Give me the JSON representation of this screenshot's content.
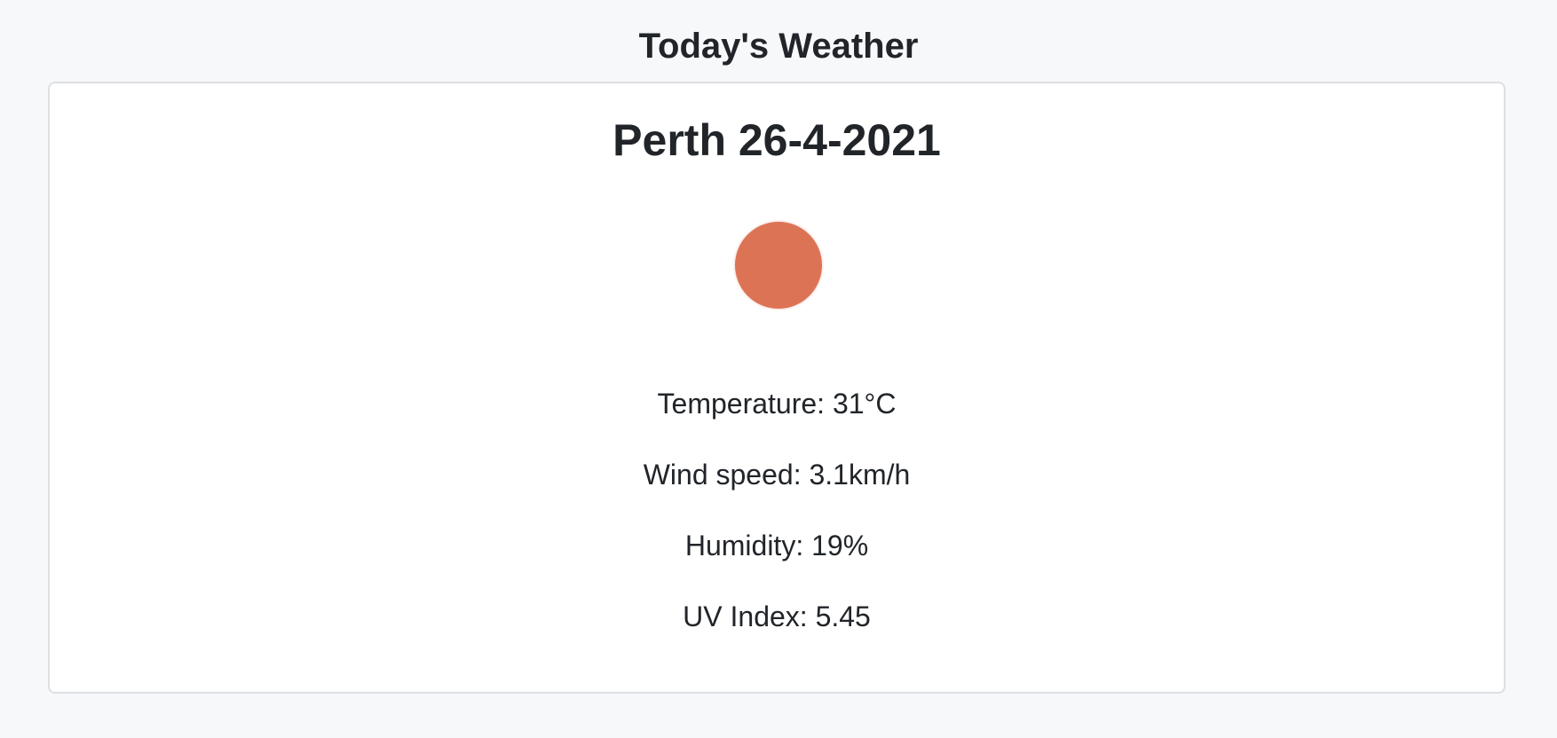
{
  "page": {
    "title": "Today's Weather"
  },
  "card": {
    "heading": "Perth 26-4-2021",
    "icon": {
      "name": "sun-icon",
      "color": "#dd7355"
    },
    "stats": {
      "temperature": "Temperature: 31°C",
      "wind_speed": "Wind speed: 3.1km/h",
      "humidity": "Humidity: 19%",
      "uv_index": "UV Index: 5.45"
    }
  }
}
